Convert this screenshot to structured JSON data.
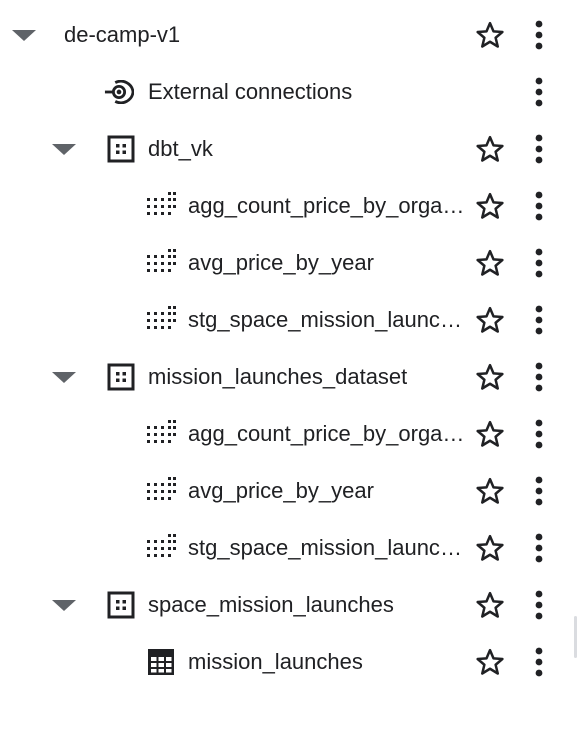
{
  "tree": {
    "project": {
      "label": "de-camp-v1",
      "icon": "caret-down-icon"
    },
    "external": {
      "label": "External connections",
      "icon": "external-connection-icon"
    },
    "datasets": [
      {
        "label": "dbt_vk",
        "icon": "dataset-icon",
        "children": [
          {
            "label": "agg_count_price_by_organisation",
            "icon": "view-icon"
          },
          {
            "label": "avg_price_by_year",
            "icon": "view-icon"
          },
          {
            "label": "stg_space_mission_launches",
            "icon": "view-icon"
          }
        ]
      },
      {
        "label": "mission_launches_dataset",
        "icon": "dataset-icon",
        "children": [
          {
            "label": "agg_count_price_by_organisation",
            "icon": "view-icon"
          },
          {
            "label": "avg_price_by_year",
            "icon": "view-icon"
          },
          {
            "label": "stg_space_mission_launches",
            "icon": "view-icon"
          }
        ]
      },
      {
        "label": "space_mission_launches",
        "icon": "dataset-icon",
        "children": [
          {
            "label": "mission_launches",
            "icon": "table-icon"
          }
        ]
      }
    ]
  },
  "colors": {
    "icon": "#202124",
    "caret": "#5f6368",
    "text": "#202124"
  }
}
